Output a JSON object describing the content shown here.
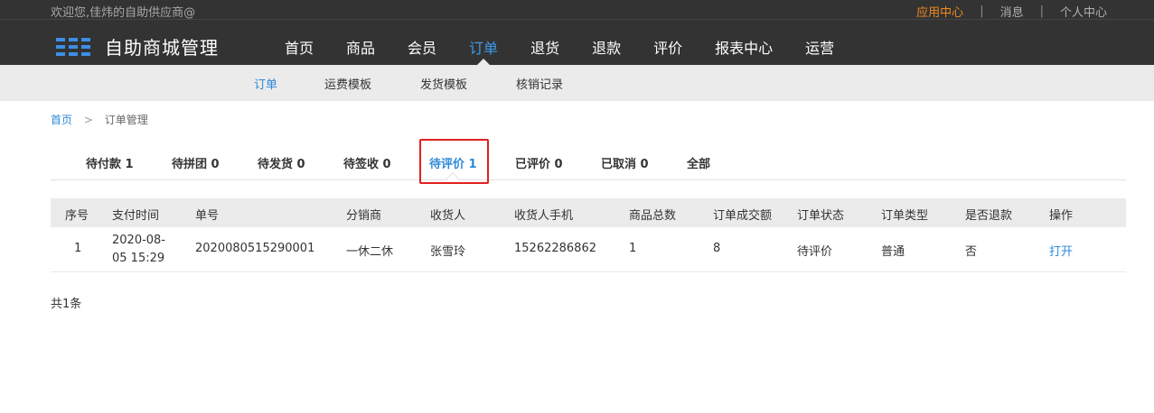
{
  "header": {
    "welcome": "欢迎您,佳炜的自助供应商@",
    "top_links": {
      "app_center": "应用中心",
      "separator": "|",
      "messages": "消息",
      "profile": "个人中心"
    },
    "logo_title": "自助商城管理",
    "nav": [
      "首页",
      "商品",
      "会员",
      "订单",
      "退货",
      "退款",
      "评价",
      "报表中心",
      "运营"
    ],
    "nav_active": "订单",
    "accent_color": "#3d9be9"
  },
  "subnav": {
    "items": [
      "订单",
      "运费模板",
      "发货模板",
      "核销记录"
    ],
    "active": "订单"
  },
  "breadcrumb": {
    "home": "首页",
    "separator": ">",
    "current": "订单管理"
  },
  "tabs": [
    {
      "label": "待付款 1"
    },
    {
      "label": "待拼团 0"
    },
    {
      "label": "待发货 0"
    },
    {
      "label": "待签收 0"
    },
    {
      "label": "待评价 1"
    },
    {
      "label": "已评价 0"
    },
    {
      "label": "已取消 0"
    },
    {
      "label": "全部"
    }
  ],
  "active_tab": "待评价 1",
  "table": {
    "columns": [
      "序号",
      "支付时间",
      "单号",
      "分销商",
      "收货人",
      "收货人手机",
      "商品总数",
      "订单成交额",
      "订单状态",
      "订单类型",
      "是否退款",
      "操作"
    ],
    "rows": [
      {
        "index": "1",
        "pay_time_line1": "2020-08-",
        "pay_time_line2": "05 15:29",
        "order_no": "2020080515290001",
        "distributor": "一休二休",
        "receiver": "张雪玲",
        "phone": "15262286862",
        "quantity": "1",
        "amount": "8",
        "status": "待评价",
        "type": "普通",
        "refund": "否",
        "action": "打开"
      }
    ]
  },
  "total_text": "共1条"
}
